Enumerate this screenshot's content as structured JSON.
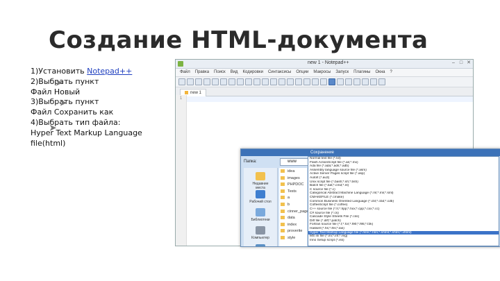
{
  "slide": {
    "title": "Создание HTML-документа",
    "steps": {
      "s1_prefix": "1)Установить ",
      "s1_link": "Notepad++",
      "s2": "2)Выбрать пункт",
      "s2a": " Файл   Новый",
      "s3": "3)Выбрать пункт",
      "s3a": " Файл   Сохранить как",
      "s4": "4)Выбрать тип файла:",
      "s4a": "Hyper Text Markup Language",
      "s4b": "file(html)"
    }
  },
  "notepad": {
    "window_title": "new  1 - Notepad++",
    "menu": [
      "Файл",
      "Правка",
      "Поиск",
      "Вид",
      "Кодировки",
      "Синтаксисы",
      "Опции",
      "Макросы",
      "Запуск",
      "Плагины",
      "Окна",
      "?"
    ],
    "tab_label": "new 1",
    "line_number": "1"
  },
  "dialog": {
    "title": "Сохранение",
    "folder_label": "Папка:",
    "folder_value": "www",
    "places": [
      "Недавние места",
      "Рабочий стол",
      "Библиотеки",
      "Компьютер",
      "Сеть"
    ],
    "files": [
      "idea",
      "images",
      "PHPDOC",
      "Tests",
      "a",
      "b",
      "cinner_page",
      "data",
      "index",
      "proverite",
      "style"
    ],
    "file_types": [
      "Normal text file (*.txt)",
      "Flash ActionScript file (*.as;*.mx)",
      "Ada file (*.ada;*.ads;*.adb)",
      "Assembly language source file (*.asm)",
      "Active Server Pages script file (*.asp)",
      "AutoIt (*.au3)",
      "Unix script file (*.bash;*.sh;*.bsh)",
      "Batch file (*.bat;*.cmd;*.nt)",
      "C source file (*.c)",
      "Categorical Abstract Machine Language (*.ml;*.mli;*.sml)",
      "CMAKEFILE (*.cmake)",
      "Common Business Oriented Language (*.cbl;*.cbd;*.cdb)",
      "CoffeeScript file (*.coffee)",
      "C++ source file (*.h;*.hpp;*.hxx;*.cpp;*.cxx;*.cc)",
      "C# source file (*.cs)",
      "Cascade Style Sheets File (*.css)",
      "Diff file (*.diff;*.patch)",
      "Fortran source file (*.f;*.for;*.f90;*.f95;*.f2k)",
      "Haskell (*.hs;*.lhs;*.las)",
      "Hyper Text Markup Language file (*.html;*.htm;*.shtml;*.shtm;*.xhtml)",
      "MS ini file (*.ini;*.inf;*.reg)",
      "Inno Setup script (*.iss)"
    ],
    "selected_index": 19
  }
}
